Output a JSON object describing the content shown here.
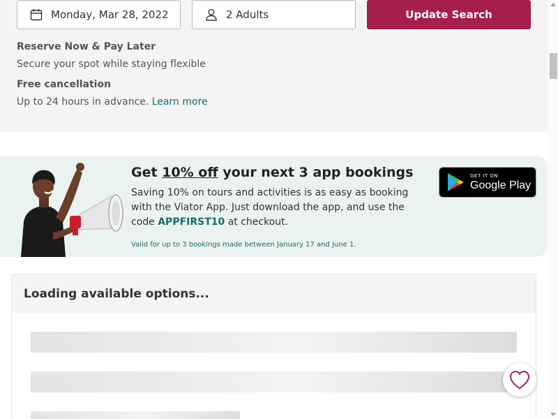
{
  "booking": {
    "date_value": "Monday, Mar 28, 2022",
    "guests_value": "2 Adults",
    "update_button_label": "Update Search",
    "perks": [
      {
        "title": "Reserve Now & Pay Later",
        "text": "Secure your spot while staying flexible"
      },
      {
        "title": "Free cancellation",
        "text": "Up to 24 hours in advance.",
        "link": "Learn more"
      }
    ],
    "icons": {
      "date": "calendar-icon",
      "guests": "person-icon"
    }
  },
  "promo": {
    "title_prefix": "Get ",
    "title_highlight": "10% off",
    "title_suffix": " your next 3 app bookings",
    "body_text": "Saving 10% on tours and activities is as easy as booking with the Viator App. Just download the app, and use the code ",
    "promo_code": "APPFIRST10",
    "body_suffix": " at checkout.",
    "fine_print": "Valid for up to 3 bookings made between January 17 and June 1.",
    "store_badge": {
      "small_text": "GET IT ON",
      "big_text": "Google Play",
      "icon": "google-play-icon"
    }
  },
  "options": {
    "loading_title": "Loading available options..."
  },
  "favorite": {
    "icon": "heart-icon"
  },
  "colors": {
    "brand_button": "#a61e4d",
    "link_teal": "#186b6d",
    "promo_background": "#ebf3f1",
    "panel_background": "#f4f4f4"
  }
}
